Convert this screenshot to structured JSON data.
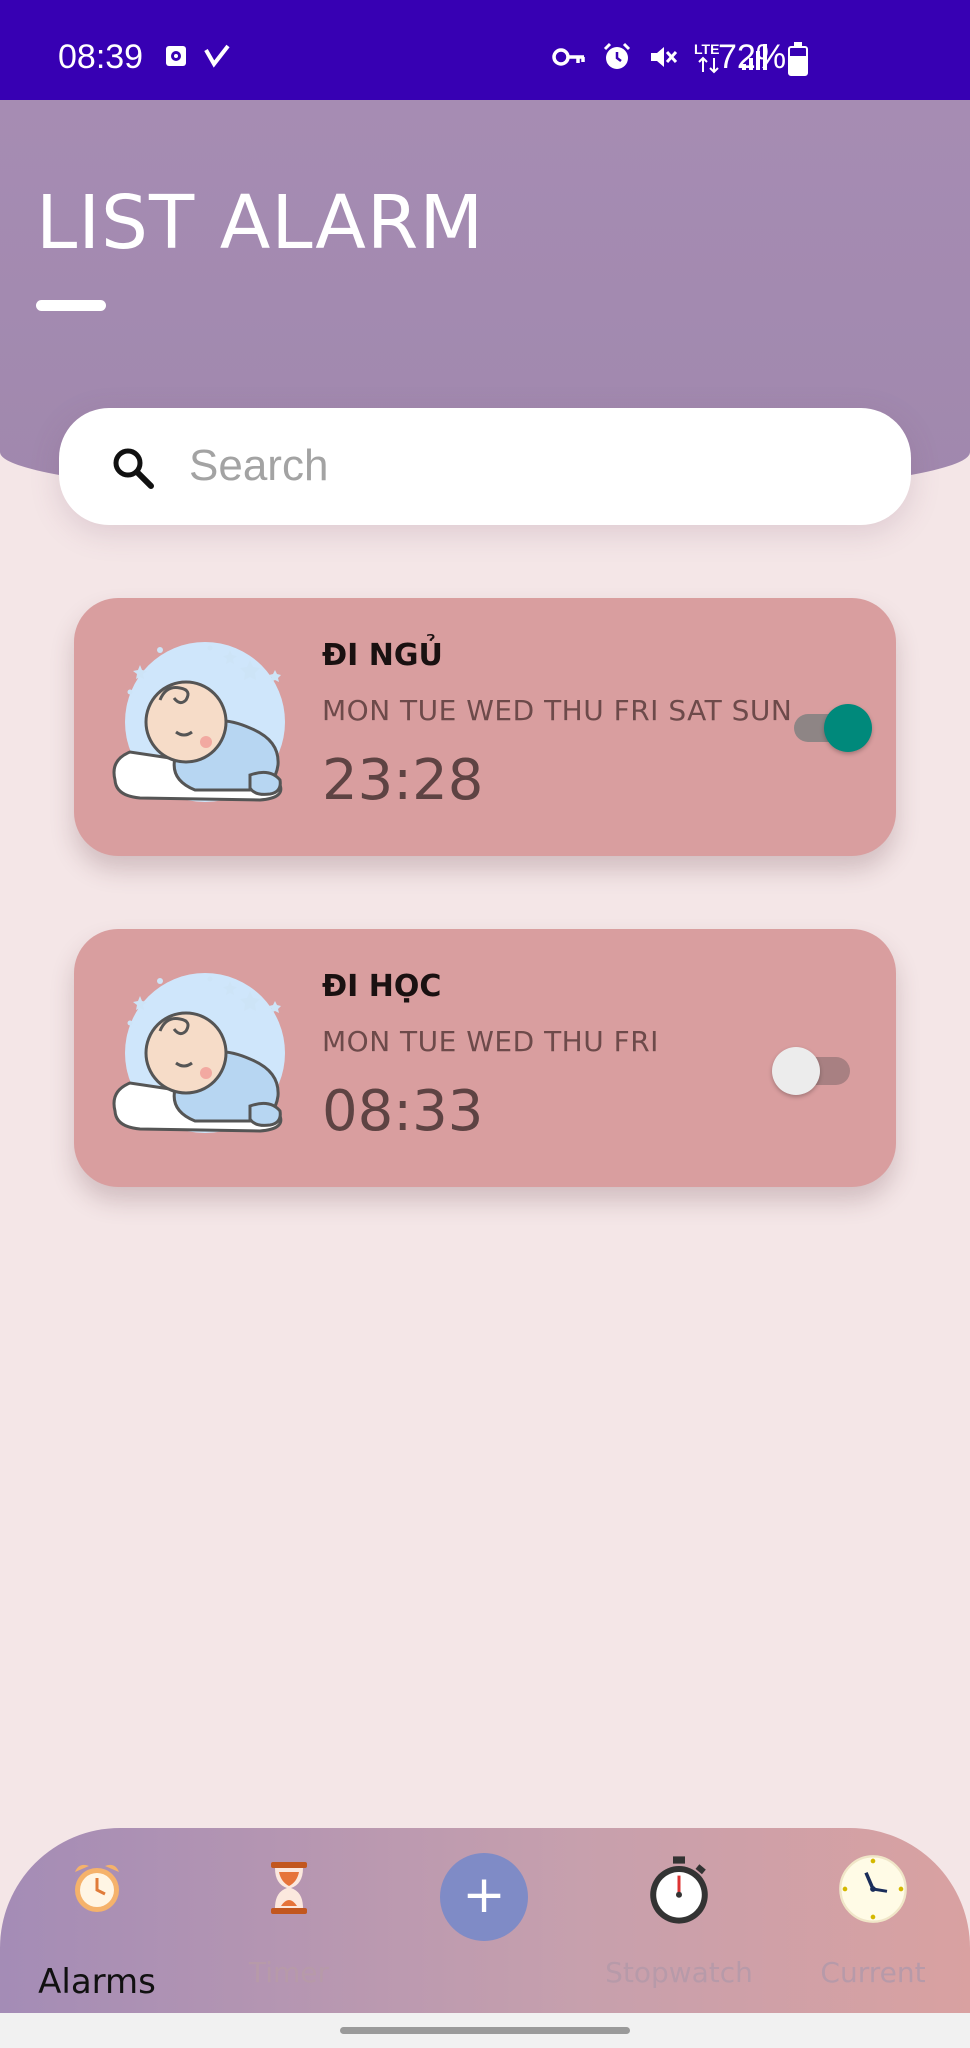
{
  "status_bar": {
    "time": "08:39",
    "battery_text": "72%",
    "left_icons": [
      "sync-icon",
      "vpn-check-icon"
    ],
    "right_icons": [
      "key-icon",
      "alarm-icon",
      "mute-icon",
      "lte-icon",
      "signal-icon",
      "battery-icon"
    ],
    "lte_label": "LTE"
  },
  "header": {
    "title": "LIST ALARM"
  },
  "search": {
    "placeholder": "Search"
  },
  "alarms": [
    {
      "name": "ĐI NGỦ",
      "days": "MON TUE WED THU FRI SAT SUN",
      "time": "23:28",
      "enabled": true
    },
    {
      "name": "ĐI HỌC",
      "days": "MON TUE WED THU FRI",
      "time": "08:33",
      "enabled": false
    }
  ],
  "bottom_nav": {
    "items": [
      {
        "label": "Alarms",
        "icon": "alarm-clock-icon",
        "active": true
      },
      {
        "label": "Timer",
        "icon": "hourglass-icon",
        "active": false
      },
      {
        "label": "+",
        "icon": "add-icon",
        "active": false
      },
      {
        "label": "Stopwatch",
        "icon": "stopwatch-icon",
        "active": false
      },
      {
        "label": "Current",
        "icon": "clock-icon",
        "active": false
      }
    ]
  },
  "colors": {
    "status_bar": "#3700b3",
    "header": "#a68cb3",
    "card": "#d99e9f",
    "toggle_on": "#00897b",
    "fab": "#7f8bc6",
    "background": "#f4e6e7"
  }
}
